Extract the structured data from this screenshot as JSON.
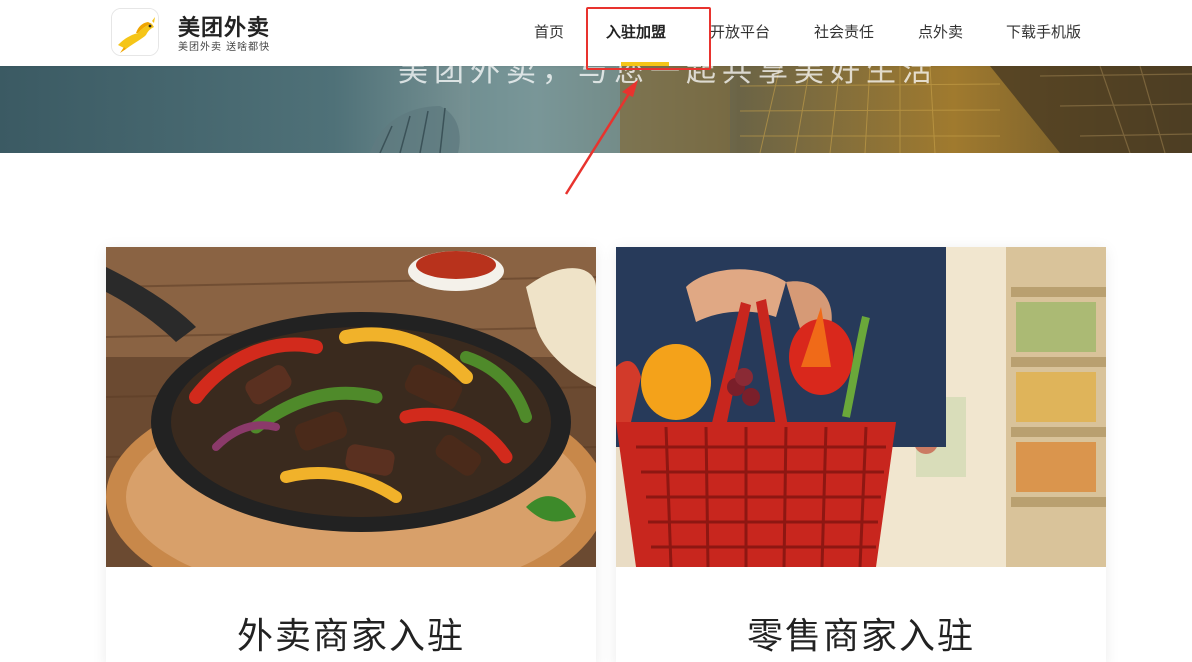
{
  "header": {
    "brand_title": "美团外卖",
    "brand_subtitle": "美团外卖 送啥都快",
    "logo_icon": "kangaroo-logo-icon"
  },
  "nav": {
    "items": [
      {
        "label": "首页",
        "active": false
      },
      {
        "label": "入驻加盟",
        "active": true
      },
      {
        "label": "开放平台",
        "active": false
      },
      {
        "label": "社会责任",
        "active": false
      },
      {
        "label": "点外卖",
        "active": false
      },
      {
        "label": "下载手机版",
        "active": false
      }
    ],
    "accent_color": "#f5c518"
  },
  "hero": {
    "text": "美团外卖，与您一起共享美好生活"
  },
  "annotation": {
    "highlight_color": "#e8332e"
  },
  "cards": [
    {
      "title": "外卖商家入驻",
      "image": "fajitas-skillet-photo"
    },
    {
      "title": "零售商家入驻",
      "image": "grocery-basket-photo"
    }
  ]
}
